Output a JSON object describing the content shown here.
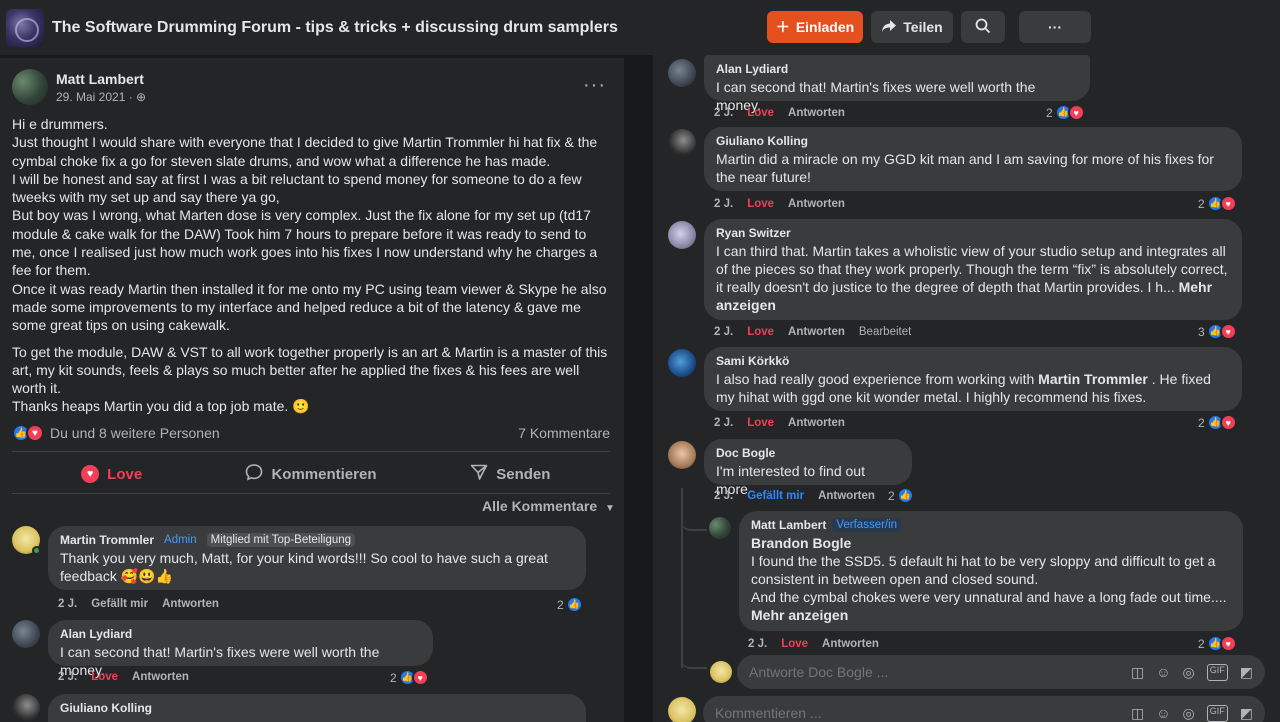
{
  "topbar": {
    "group_title": "The Software Drumming Forum - tips & tricks + discussing drum samplers",
    "invite_label": "Einladen",
    "share_label": "Teilen",
    "accent_color": "#e4511f"
  },
  "post": {
    "author": "Matt Lambert",
    "date": "29. Mai 2021 · ",
    "paragraphs": [
      "Hi e drummers.",
      "Just thought I would share with everyone that I decided to give Martin Trommler hi hat fix & the cymbal choke fix a go for steven slate drums, and wow what a difference he has made.",
      "I will be honest and say at first I was a bit reluctant to spend money for someone to do a few tweeks with my set up and say there ya go,",
      "But boy was I wrong, what Marten dose is very complex. Just the fix alone for my set up (td17 module & cake walk for the DAW) Took him 7 hours to prepare before it was ready to send to me, once I realised just how much work goes into his fixes I now understand why he charges a fee for them.",
      "Once it was ready Martin then installed it for me onto my PC using team viewer & Skype he also made some improvements to my interface and helped reduce a bit of the latency & gave me some great tips on using cakewalk.",
      "To get the module, DAW & VST to all work together properly is an art & Martin is a master of this art, my kit sounds, feels & plays so much better after he applied the fixes & his fees are well worth it.",
      "Thanks heaps Martin you did a top job mate. 🙂"
    ],
    "reactions_text": "Du und 8 weitere Personen",
    "comments_count": "7 Kommentare",
    "love_label": "Love",
    "comment_label": "Kommentieren",
    "send_label": "Senden",
    "sort_label": "Alle Kommentare"
  },
  "left_comments": [
    {
      "author": "Martin Trommler",
      "badge_admin": "Admin",
      "badge_top": "Mitglied mit Top-Beteiligung",
      "text": "Thank you very much, Matt, for your kind words!!! So cool to have such a great feedback 🥰😃👍",
      "time": "2 J.",
      "like_action": "Gefällt mir",
      "reply_action": "Antworten",
      "reactions": "2"
    },
    {
      "author": "Alan Lydiard",
      "text": "I can second that! Martin's fixes were well worth the money.",
      "time": "2 J.",
      "like_action": "Love",
      "reply_action": "Antworten",
      "reactions": "2"
    },
    {
      "author": "Giuliano Kolling"
    }
  ],
  "right_comments": [
    {
      "author": "Alan Lydiard",
      "text": "I can second that! Martin's fixes were well worth the money.",
      "time": "2 J.",
      "like_action": "Love",
      "reply_action": "Antworten",
      "reactions": "2"
    },
    {
      "author": "Giuliano Kolling",
      "text": "Martin did a miracle on my GGD kit man and I am saving for more of his fixes for the near future!",
      "time": "2 J.",
      "like_action": "Love",
      "reply_action": "Antworten",
      "reactions": "2"
    },
    {
      "author": "Ryan Switzer",
      "text": "I can third that. Martin takes a wholistic view of your studio setup and integrates all of the pieces so that they work properly. Though the term “fix” is absolutely correct, it really doesn't do justice to the degree of depth that Martin provides. I h...",
      "more": "Mehr anzeigen",
      "time": "2 J.",
      "like_action": "Love",
      "reply_action": "Antworten",
      "edited": "Bearbeitet",
      "reactions": "3"
    },
    {
      "author": "Sami Körkkö",
      "text_before": "I also had really good experience from working with ",
      "mention": "Martin Trommler",
      "text_after": " . He fixed my hihat with ggd one kit wonder metal. I highly recommend his fixes.",
      "time": "2 J.",
      "like_action": "Love",
      "reply_action": "Antworten",
      "reactions": "2"
    },
    {
      "author": "Doc Bogle",
      "text": "I'm interested to find out more",
      "time": "2 J.",
      "like_action": "Gefällt mir",
      "reply_action": "Antworten",
      "reactions": "2"
    }
  ],
  "reply": {
    "author": "Matt Lambert",
    "badge": "Verfasser/in",
    "mention": "Brandon Bogle",
    "lines": [
      "I found the the SSD5. 5 default hi hat to be very sloppy and difficult to get a consistent in between open and closed sound.",
      "And the cymbal chokes were very unnatural and have a long fade out time...."
    ],
    "more": "Mehr anzeigen",
    "time": "2 J.",
    "like_action": "Love",
    "reply_action": "Antworten",
    "reactions": "2"
  },
  "inputs": {
    "reply_placeholder": "Antworte Doc Bogle ...",
    "comment_placeholder": "Kommentieren ..."
  },
  "icons": {
    "invite": "plus-icon",
    "share": "share-arrow-icon",
    "search": "search-icon",
    "more": "ellipsis-icon",
    "globe": "globe-icon",
    "heart": "heart-icon",
    "comment": "comment-bubble-icon",
    "send": "send-icon",
    "caret": "caret-down-icon",
    "sticker": "sticker-icon",
    "emoji": "emoji-icon",
    "camera": "camera-icon",
    "gif": "gif-icon",
    "label": "label-icon"
  }
}
